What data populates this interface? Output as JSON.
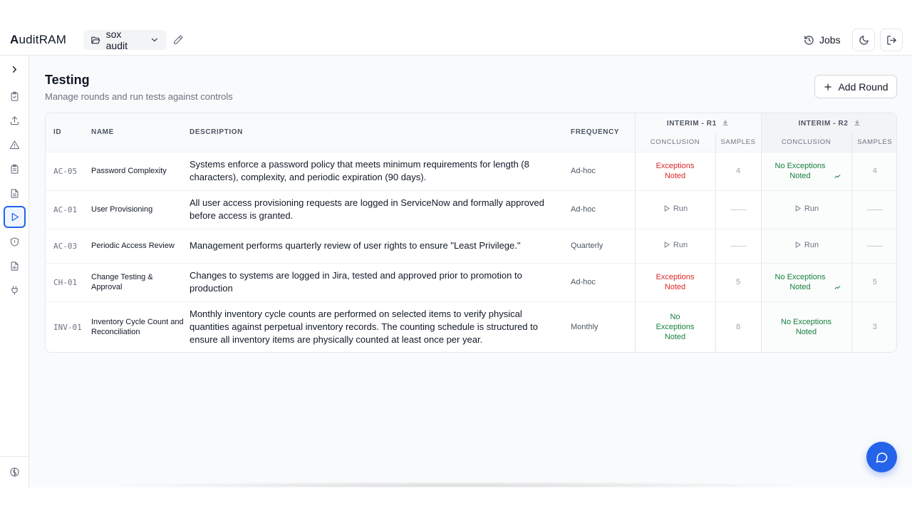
{
  "app": {
    "logo_a": "A",
    "logo_rest": "uditRAM"
  },
  "header": {
    "project_name": "sox audit",
    "jobs_label": "Jobs"
  },
  "page": {
    "title": "Testing",
    "subtitle": "Manage rounds and run tests against controls",
    "add_round_label": "Add Round"
  },
  "table": {
    "columns": {
      "id": "ID",
      "name": "NAME",
      "description": "DESCRIPTION",
      "frequency": "FREQUENCY"
    },
    "rounds": [
      {
        "label": "INTERIM - R1",
        "conclusion_label": "CONCLUSION",
        "samples_label": "SAMPLES"
      },
      {
        "label": "INTERIM - R2",
        "conclusion_label": "CONCLUSION",
        "samples_label": "SAMPLES"
      }
    ],
    "run_label": "Run",
    "rows": [
      {
        "id": "AC-05",
        "name": "Password Complexity",
        "description": "Systems enforce a password policy that meets minimum requirements for length (8 characters), complexity, and periodic expiration (90 days).",
        "frequency": "Ad-hoc",
        "r1": {
          "status": "exceptions",
          "conclusion": "Exceptions Noted",
          "samples": "4"
        },
        "r2": {
          "status": "noexceptions",
          "conclusion": "No Exceptions Noted",
          "samples": "4",
          "trend": true
        }
      },
      {
        "id": "AC-01",
        "name": "User Provisioning",
        "description": "All user access provisioning requests are logged in ServiceNow and formally approved before access is granted.",
        "frequency": "Ad-hoc",
        "r1": {
          "status": "run"
        },
        "r2": {
          "status": "run"
        }
      },
      {
        "id": "AC-03",
        "name": "Periodic Access Review",
        "description": "Management performs quarterly review of user rights to ensure \"Least Privilege.\"",
        "frequency": "Quarterly",
        "r1": {
          "status": "run"
        },
        "r2": {
          "status": "run"
        }
      },
      {
        "id": "CH-01",
        "name": "Change Testing & Approval",
        "description": "Changes to systems are logged in Jira, tested and approved prior to promotion to production",
        "frequency": "Ad-hoc",
        "r1": {
          "status": "exceptions",
          "conclusion": "Exceptions Noted",
          "samples": "5"
        },
        "r2": {
          "status": "noexceptions",
          "conclusion": "No Exceptions Noted",
          "samples": "5",
          "trend": true
        }
      },
      {
        "id": "INV-01",
        "name": "Inventory Cycle Count and Reconciliation",
        "description": "Monthly inventory cycle counts are performed on selected items to verify physical quantities against perpetual inventory records. The counting schedule is structured to ensure all inventory items are physically counted at least once per year.",
        "frequency": "Monthly",
        "r1": {
          "status": "noexceptions",
          "conclusion": "No Exceptions Noted",
          "samples": "8"
        },
        "r2": {
          "status": "noexceptions",
          "conclusion": "No Exceptions Noted",
          "samples": "3"
        }
      }
    ]
  },
  "colors": {
    "accent": "#2563eb",
    "exception": "#dc2626",
    "success": "#15803d"
  },
  "icons": {
    "sidebar": [
      "chevron-right-icon",
      "clipboard-check-icon",
      "upload-icon",
      "alert-triangle-icon",
      "clipboard-list-icon",
      "file-text-icon",
      "play-icon",
      "shield-icon",
      "file-chart-icon",
      "plug-icon",
      "brain-icon"
    ]
  }
}
